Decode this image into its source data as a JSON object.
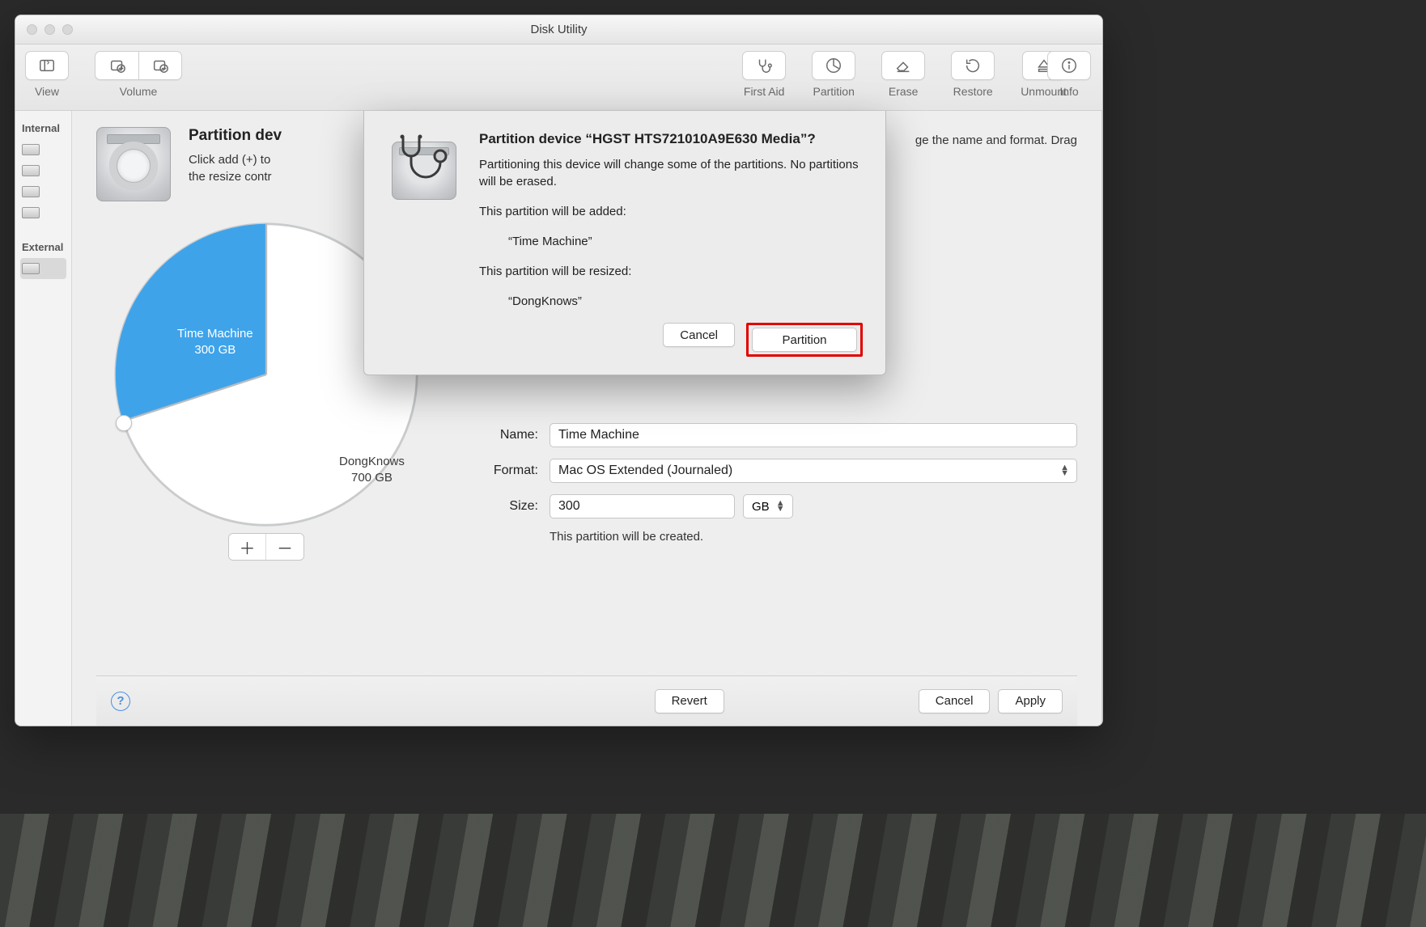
{
  "window": {
    "title": "Disk Utility"
  },
  "toolbar": {
    "view": "View",
    "volume": "Volume",
    "first_aid": "First Aid",
    "partition": "Partition",
    "erase": "Erase",
    "restore": "Restore",
    "unmount": "Unmount",
    "info": "Info"
  },
  "sidebar": {
    "internal": "Internal",
    "external": "External"
  },
  "sheet": {
    "title_prefix": "Partition dev",
    "subtitle_line1": "Click add (+) to",
    "subtitle_line2": "the resize contr",
    "meta": "ge the name and format. Drag"
  },
  "pie": {
    "slice1_name": "Time Machine",
    "slice1_size": "300 GB",
    "slice2_name": "DongKnows",
    "slice2_size": "700 GB"
  },
  "form": {
    "name_label": "Name:",
    "name_value": "Time Machine",
    "format_label": "Format:",
    "format_value": "Mac OS Extended (Journaled)",
    "size_label": "Size:",
    "size_value": "300",
    "size_unit": "GB",
    "hint": "This partition will be created."
  },
  "footer": {
    "revert": "Revert",
    "cancel": "Cancel",
    "apply": "Apply"
  },
  "modal": {
    "title": "Partition device “HGST HTS721010A9E630 Media”?",
    "body": "Partitioning this device will change some of the partitions. No partitions will be erased.",
    "added_head": "This partition will be added:",
    "added_name": "“Time Machine”",
    "resized_head": "This partition will be resized:",
    "resized_name": "“DongKnows”",
    "cancel": "Cancel",
    "partition": "Partition"
  },
  "chart_data": {
    "type": "pie",
    "title": "",
    "series": [
      {
        "name": "Time Machine",
        "value": 300,
        "unit": "GB",
        "color": "#3fa3ea"
      },
      {
        "name": "DongKnows",
        "value": 700,
        "unit": "GB",
        "color": "#ffffff"
      }
    ],
    "total": 1000
  }
}
